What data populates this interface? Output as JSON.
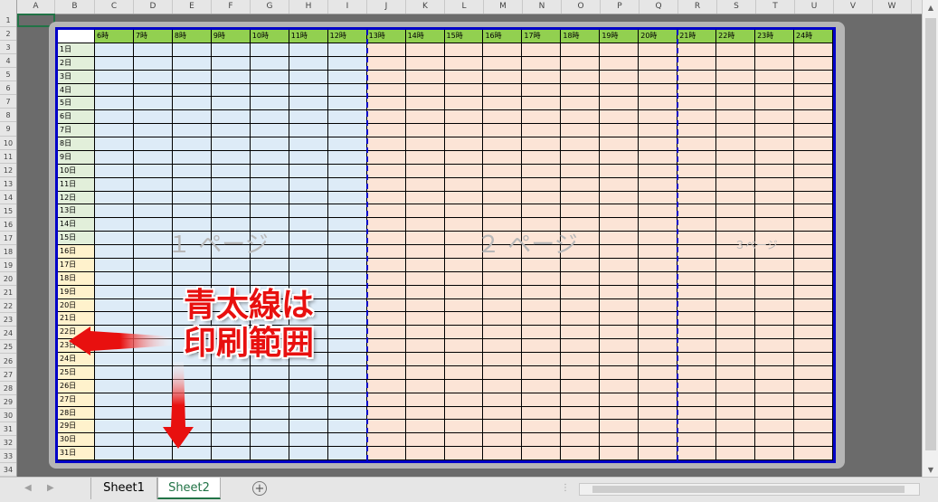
{
  "columns": [
    "A",
    "B",
    "C",
    "D",
    "E",
    "F",
    "G",
    "H",
    "I",
    "J",
    "K",
    "L",
    "M",
    "N",
    "O",
    "P",
    "Q",
    "R",
    "S",
    "T",
    "U",
    "V",
    "W"
  ],
  "rows": [
    "1",
    "2",
    "3",
    "4",
    "5",
    "6",
    "7",
    "8",
    "9",
    "10",
    "11",
    "12",
    "13",
    "14",
    "15",
    "16",
    "17",
    "18",
    "19",
    "20",
    "21",
    "22",
    "23",
    "24",
    "25",
    "26",
    "27",
    "28",
    "29",
    "30",
    "31",
    "32",
    "33",
    "34"
  ],
  "hours": [
    "6時",
    "7時",
    "8時",
    "9時",
    "10時",
    "11時",
    "12時",
    "13時",
    "14時",
    "15時",
    "16時",
    "17時",
    "18時",
    "19時",
    "20時",
    "21時",
    "22時",
    "23時",
    "24時"
  ],
  "days": [
    "1日",
    "2日",
    "3日",
    "4日",
    "5日",
    "6日",
    "7日",
    "8日",
    "9日",
    "10日",
    "11日",
    "12日",
    "13日",
    "14日",
    "15日",
    "16日",
    "17日",
    "18日",
    "19日",
    "20日",
    "21日",
    "22日",
    "23日",
    "24日",
    "25日",
    "26日",
    "27日",
    "28日",
    "29日",
    "30日",
    "31日"
  ],
  "watermarks": {
    "page1": "１ ページ",
    "page2": "２ ページ",
    "page3": "３ページ"
  },
  "callout": {
    "line1": "青太線は",
    "line2": "印刷範囲"
  },
  "tabs": [
    "Sheet1",
    "Sheet2"
  ],
  "active_tab": "Sheet2",
  "add_sheet_symbol": "+",
  "colors": {
    "header_green": "#92d050",
    "page1_fill": "#ddebf7",
    "page2_fill": "#fce4d6",
    "day_green": "#e2efda",
    "day_yellow": "#fff2cc",
    "border_blue": "#0000c8",
    "arrow_red": "#e8100f"
  }
}
